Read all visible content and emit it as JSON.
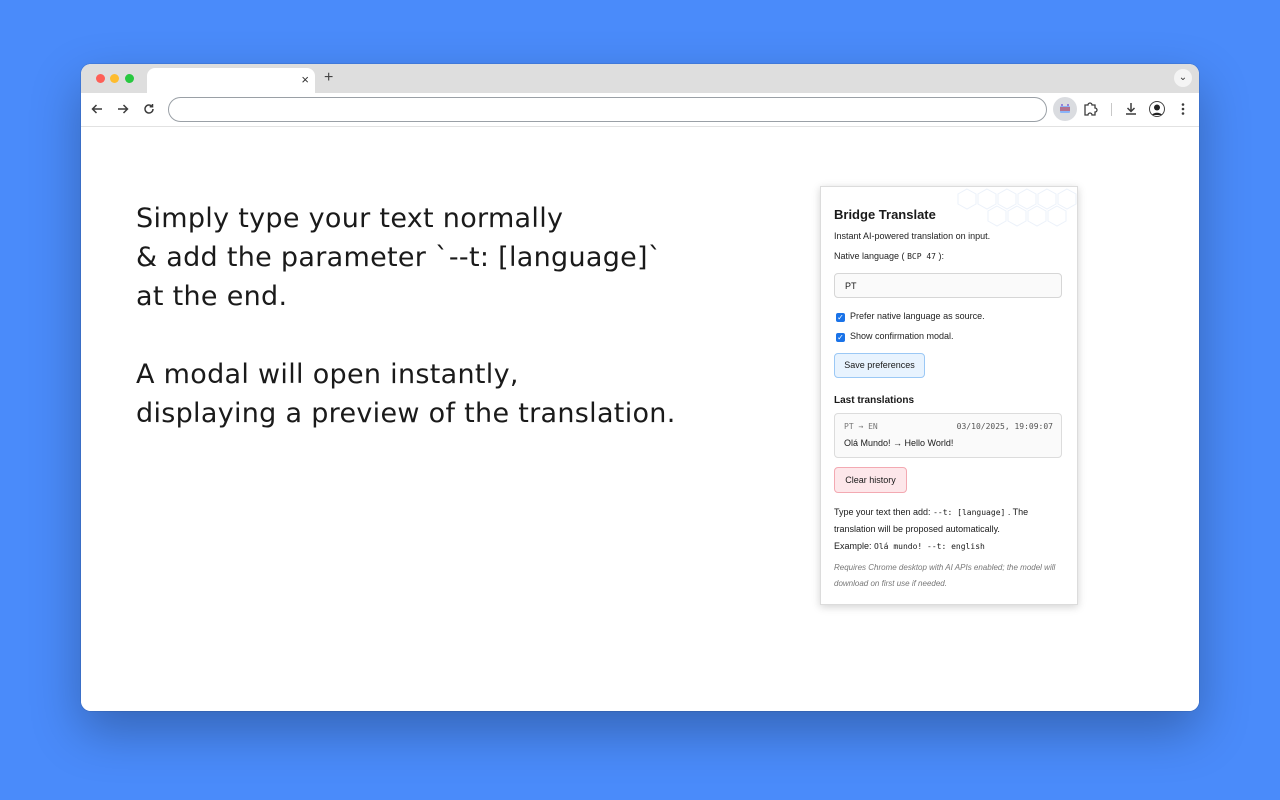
{
  "browser": {
    "tab_close": "×",
    "new_tab": "+",
    "tab_menu": "⌄",
    "omnibox_value": ""
  },
  "hero": {
    "line1": "Simply type your text normally",
    "line2": "& add the parameter `--t: [language]`",
    "line3": "at the end.",
    "line4": "A modal will open instantly,",
    "line5": "displaying a preview of the translation."
  },
  "popup": {
    "title": "Bridge Translate",
    "subtitle": "Instant AI-powered translation on input.",
    "native_label_prefix": "Native language (",
    "native_label_code": "BCP 47",
    "native_label_suffix": "):",
    "native_value": "PT",
    "prefer_native_label": "Prefer native language as source.",
    "prefer_native_checked": true,
    "show_modal_label": "Show confirmation modal.",
    "show_modal_checked": true,
    "save_button": "Save preferences",
    "history_title": "Last translations",
    "history": [
      {
        "langs": "PT → EN",
        "time": "03/10/2025, 19:09:07",
        "text": "Olá Mundo! → Hello World!"
      }
    ],
    "clear_button": "Clear history",
    "help_prefix": "Type your text then add:",
    "help_code": "--t: [language]",
    "help_suffix": ". The",
    "help_line2": "translation will be proposed automatically.",
    "example_label": "Example:",
    "example_code": "Olá mundo! --t: english",
    "requirements_note": "Requires Chrome desktop with AI APIs enabled; the model will download on first use if needed."
  },
  "colors": {
    "background": "#4a8bfa",
    "checkbox": "#1a73e8",
    "save_bg": "#e8f3fe",
    "clear_bg": "#fde7ea"
  }
}
